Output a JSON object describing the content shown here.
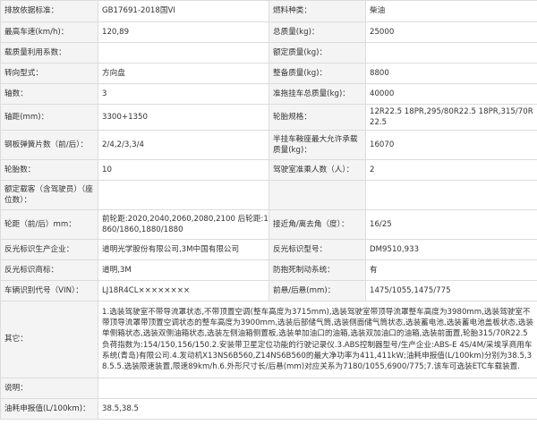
{
  "rows": [
    {
      "l1": "排放依据标准：",
      "v1": "GB17691-2018国VI",
      "l2": "燃料种类：",
      "v2": "柴油"
    },
    {
      "l1": "最高车速(km/h)：",
      "v1": "120,89",
      "l2": "总质量(kg)：",
      "v2": "25000"
    },
    {
      "l1": "载质量利用系数：",
      "v1": "",
      "l2": "额定质量(kg)：",
      "v2": ""
    },
    {
      "l1": "转向型式：",
      "v1": "方向盘",
      "l2": "整备质量(kg)：",
      "v2": "8800"
    },
    {
      "l1": "轴数：",
      "v1": "3",
      "l2": "准拖挂车总质量(kg)：",
      "v2": "40000"
    },
    {
      "l1": "轴距(mm)：",
      "v1": "3300+1350",
      "l2": "轮胎规格：",
      "v2": "12R22.5 18PR,295/80R22.5 18PR,315/70R22.5"
    },
    {
      "l1": "钢板弹簧片数（前/后）：",
      "v1": "2/4,2/3,3/4",
      "l2": "半挂车鞍座最大允许承载质量(kg)：",
      "v2": "16070"
    },
    {
      "l1": "轮胎数：",
      "v1": "10",
      "l2": "驾驶室准乘人数（人）：",
      "v2": "2"
    },
    {
      "l1": "额定载客（含驾驶员）（座位数）：",
      "v1": "",
      "l2": "",
      "v2": ""
    },
    {
      "l1": "轮距（前/后）mm：",
      "v1": "前轮距:2020,2040,2060,2080,2100 后轮距:1860/1860,1880/1880",
      "l2": "接近角/离去角（度）：",
      "v2": "16/25"
    },
    {
      "l1": "反光标识生产企业：",
      "v1": "道明光学股份有限公司,3M中国有限公司",
      "l2": "反光标识型号：",
      "v2": "DM9510,933"
    },
    {
      "l1": "反光标识商标：",
      "v1": "道明,3M",
      "l2": "防抱死制动系统：",
      "v2": "有"
    },
    {
      "l1": "车辆识别代号（VIN）：",
      "v1": "LJ18R4CL××××××××",
      "l2": "前悬/后悬(mm)：",
      "v2": "1475/1055,1475/775"
    }
  ],
  "other": {
    "label": "其它：",
    "value": "1.选装驾驶室不带导流罩状态,不带顶置空调(整车高度为3715mm),选装驾驶室带顶导流罩整车高度为3980mm,选装驾驶室不带顶导流罩带顶置空调状态的整车高度为3900mm,选装后部储气筒,选装侧面储气筒状态,选装蓄电池,选装蓄电池盖板状态,选装单侧箱状态,选装双侧油箱状态,选装左侧油箱侧置板,选装单加油口的油箱,选装双加油口的油箱,选装前面置,轮胎315/70R22.5负荷指数为:154/150,156/150.2.安装带卫星定位功能的行驶记录仪.3.ABS控制器型号/生产企业:ABS-E 4S/4M/采埃孚商用车系统(青岛)有限公司.4.发动机X13NS6B560,Z14NS6B560的最大净功率为411,411kW;油耗申报值(L/100km)分别为38.5,38.5.5.选装限速装置,限速89km/h.6.外形尺寸长/后悬(mm)对应关系为7180/1055,6900/775;7.该车可选装ETC车载装置."
  },
  "note": {
    "label": "说明：",
    "value": ""
  },
  "fuel": {
    "label": "油耗申报值(L/100km)：",
    "value": "38.5,38.5"
  }
}
